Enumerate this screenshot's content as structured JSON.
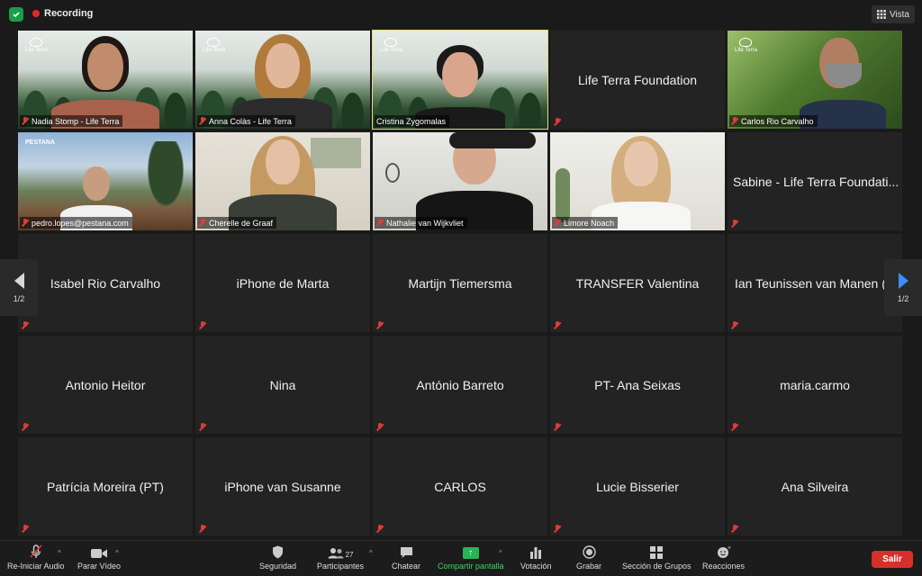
{
  "topbar": {
    "recording_label": "Recording",
    "view_label": "Vista"
  },
  "colors": {
    "recording": "#e02a2a",
    "active_speaker_border": "#e3dd7d",
    "leave": "#d6302b",
    "share": "#29b45a",
    "nav_arrow": "#3d8dff"
  },
  "pager": {
    "left_label": "1/2",
    "right_label": "1/2"
  },
  "participants_video": [
    {
      "name": "Nadia Stomp - Life Terra",
      "logo": "Life Terra"
    },
    {
      "name": "Anna Colàs - Life Terra",
      "logo": "Life Terra"
    },
    {
      "name": "Cristina Zygomalas",
      "logo": "Life Terra"
    },
    {
      "name": "Carlos Rio Carvalho",
      "logo": "Life Terra"
    },
    {
      "name": "pedro.lopes@pestana.com",
      "logo": "PESTANA"
    },
    {
      "name": "Cherelle de Graaf"
    },
    {
      "name": "Nathalie van Wijkvliet"
    },
    {
      "name": "Limore Noach"
    }
  ],
  "participants_text": [
    "Life Terra Foundation",
    "Sabine - Life Terra Foundati...",
    "Isabel Rio Carvalho",
    "iPhone de Marta",
    "Martijn Tiemersma",
    "TRANSFER Valentina",
    "Ian Teunissen van Manen (E...",
    "Antonio Heitor",
    "Nina",
    "António Barreto",
    "PT- Ana Seixas",
    "maria.carmo",
    "Patrícia Moreira (PT)",
    "iPhone van Susanne",
    "CARLOS",
    "Lucie Bisserier",
    "Ana Silveira"
  ],
  "toolbar": {
    "audio": "Re-Iniciar Audio",
    "video": "Parar Vídeo",
    "security": "Seguridad",
    "participants": "Participantes",
    "participants_count": "27",
    "chat": "Chatear",
    "share": "Compartir pantalla",
    "poll": "Votación",
    "record": "Grabar",
    "groups": "Sección de Grupos",
    "reactions": "Reacciones",
    "leave": "Salir"
  }
}
